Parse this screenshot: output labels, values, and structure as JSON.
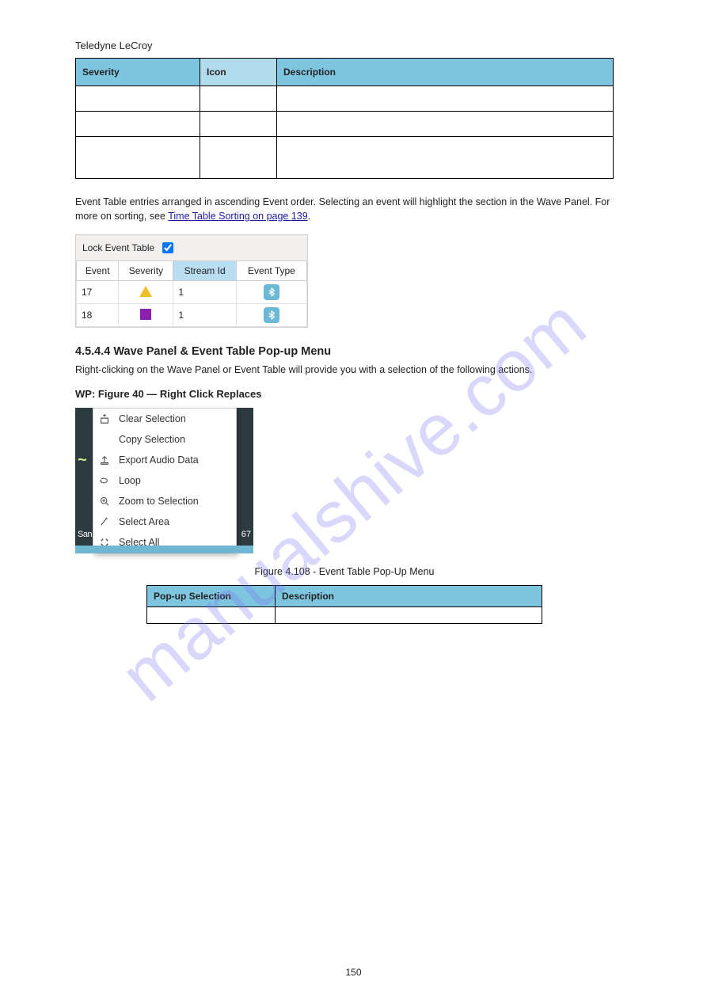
{
  "watermark": "manualshive.com",
  "pageTitle": "Teledyne LeCroy",
  "severityTable": {
    "headers": {
      "col1": "Severity",
      "col2": "Icon",
      "col3": "Description"
    },
    "rows": [
      {
        "label": "",
        "icon": "",
        "desc": ""
      },
      {
        "label": "",
        "icon": "",
        "desc": ""
      },
      {
        "label": "",
        "icon": "",
        "desc": ""
      }
    ]
  },
  "paragraph": {
    "pre": "Event Table entries arranged in ascending Event order. Selecting an event will highlight the section in the Wave Panel. For more on sorting, see ",
    "linkText": "Time Table Sorting on page 139",
    "post": "."
  },
  "lockBox": {
    "label": "Lock Event Table",
    "checked": true,
    "headers": {
      "event": "Event",
      "severity": "Severity",
      "streamId": "Stream Id",
      "eventType": "Event Type"
    },
    "rows": [
      {
        "event": "17",
        "severity": "triangle",
        "streamId": "1",
        "type": "bt"
      },
      {
        "event": "18",
        "severity": "square",
        "streamId": "1",
        "type": "bt"
      }
    ]
  },
  "heading4": "4.5.4.4   Wave Panel & Event Table Pop-up Menu",
  "introText": "Right-clicking on the Wave Panel or Event Table will provide you with a selection of the following actions.",
  "subhead1": "WP: Figure 40 — Right Click Replaces",
  "ctx": {
    "leftText": "San",
    "rightText": "67",
    "items": [
      {
        "icon": "clear",
        "label": "Clear Selection"
      },
      {
        "icon": "copy",
        "label": "Copy Selection"
      },
      {
        "icon": "export",
        "label": "Export Audio Data"
      },
      {
        "icon": "loop",
        "label": "Loop"
      },
      {
        "icon": "zoom",
        "label": "Zoom to Selection"
      },
      {
        "icon": "select",
        "label": "Select Area"
      },
      {
        "icon": "all",
        "label": "Select All"
      }
    ]
  },
  "centerCaption": "Figure 4.108 - Event Table Pop-Up Menu",
  "popupTable": {
    "headers": {
      "col1": "Pop-up Selection",
      "col2": "Description"
    },
    "row": {
      "c1": "",
      "c2": ""
    }
  },
  "pageNumber": "150"
}
